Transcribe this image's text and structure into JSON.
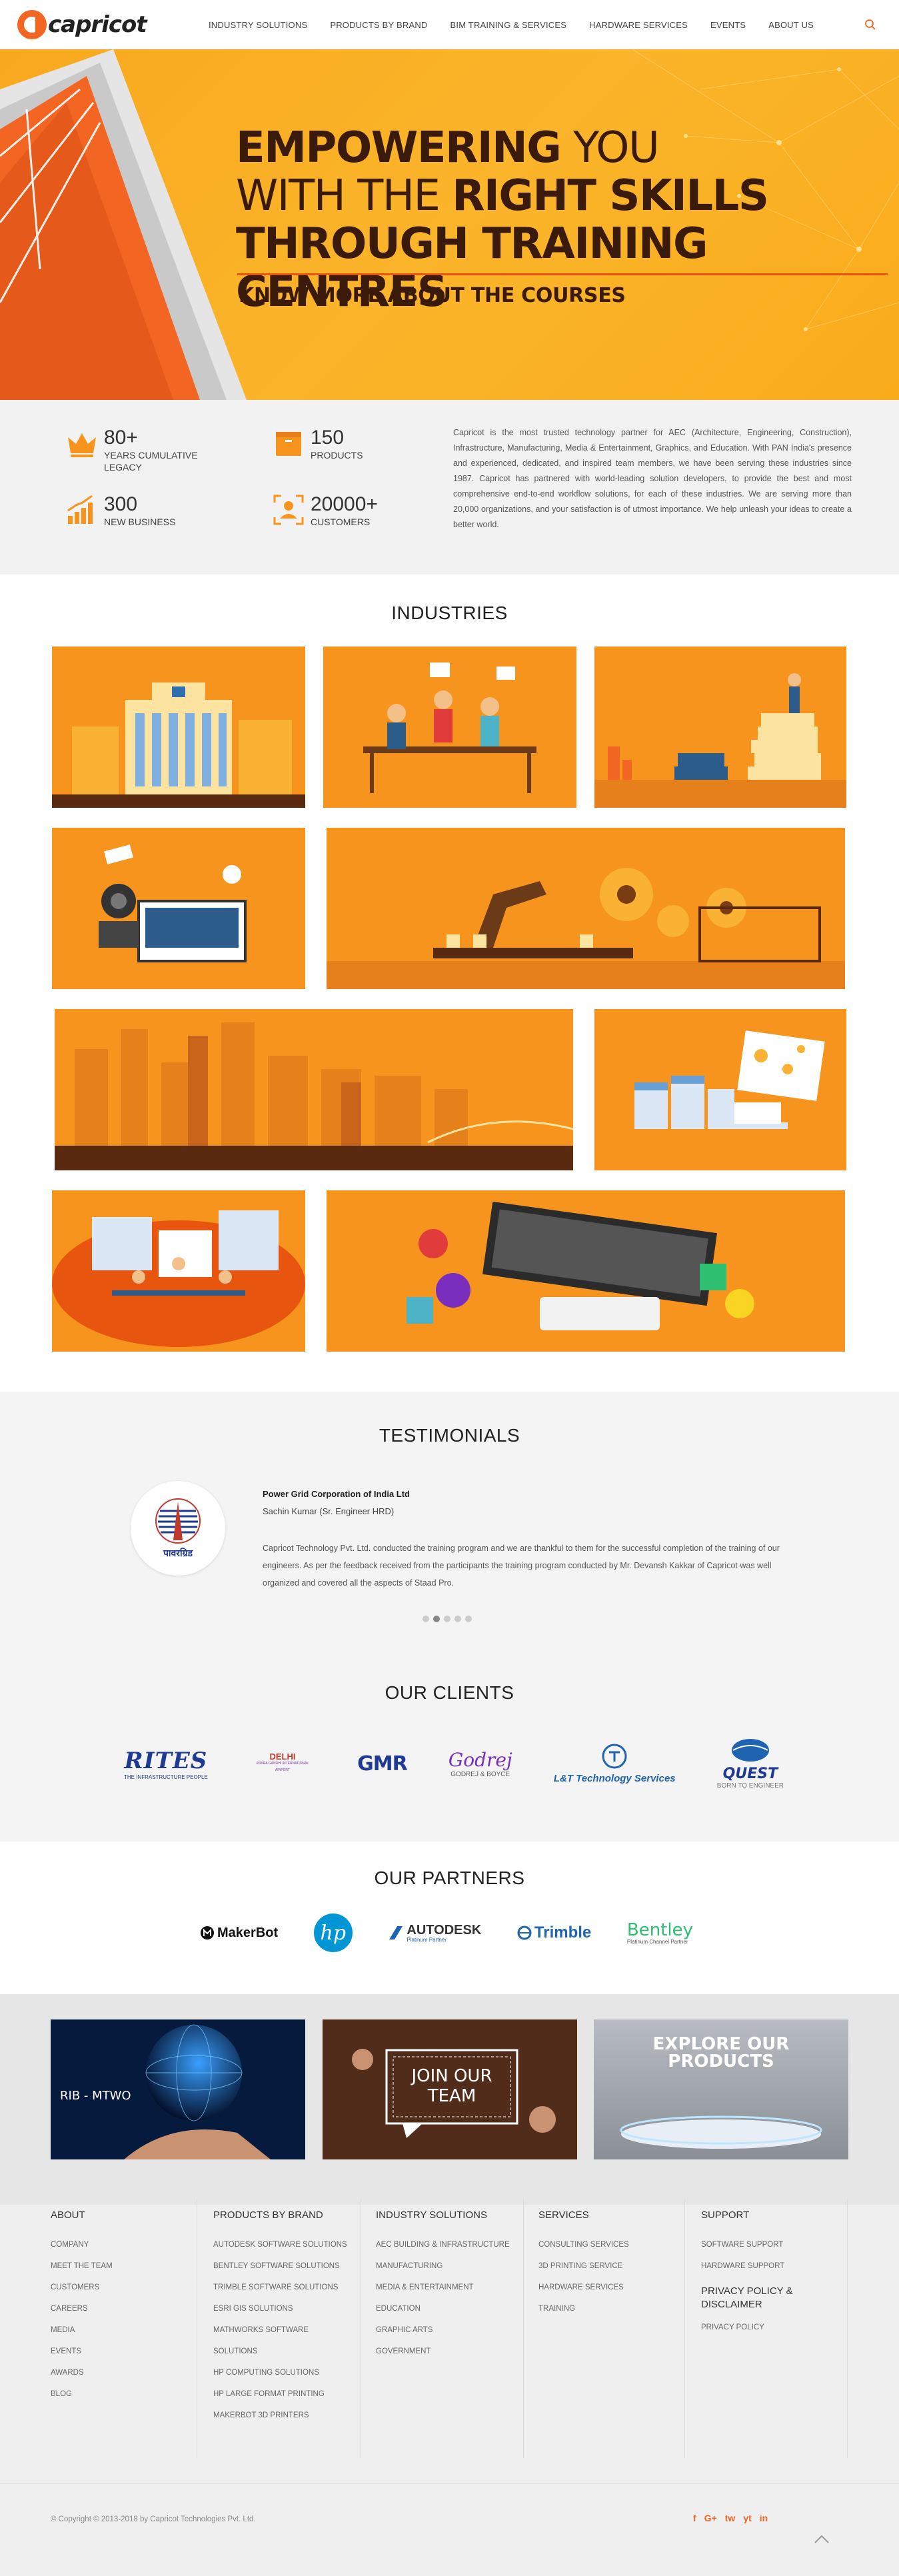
{
  "brand": {
    "name": "capricot",
    "accent": "#f26522",
    "hero_bg": "#fbb124"
  },
  "nav": {
    "items": [
      {
        "label": "INDUSTRY SOLUTIONS"
      },
      {
        "label": "PRODUCTS BY BRAND"
      },
      {
        "label": "BIM TRAINING & SERVICES"
      },
      {
        "label": "HARDWARE SERVICES"
      },
      {
        "label": "EVENTS"
      },
      {
        "label": "ABOUT US"
      }
    ],
    "search_icon": "search-icon"
  },
  "hero": {
    "line1_bold": "EMPOWERING",
    "line1_light": " YOU",
    "line2_light": "WITH THE ",
    "line2_bold": "RIGHT SKILLS",
    "line3_bold": "THROUGH TRAINING CENTRES",
    "cta": "KNOW MORE ABOUT THE COURSES"
  },
  "stats": [
    {
      "num": "80+",
      "label": "YEARS CUMULATIVE LEGACY",
      "icon": "crown-icon"
    },
    {
      "num": "150",
      "label": "PRODUCTS",
      "icon": "box-icon"
    },
    {
      "num": "300",
      "label": "NEW BUSINESS",
      "icon": "growth-chart-icon"
    },
    {
      "num": "20000+",
      "label": "CUSTOMERS",
      "icon": "customer-icon"
    }
  ],
  "about": "Capricot is the most trusted technology partner for AEC (Architecture, Engineering, Construction), Infrastructure, Manufacturing, Media & Entertainment, Graphics, and Education. With PAN India's presence and experienced, dedicated, and inspired team members, we have been serving these industries since 1987. Capricot has partnered with world-leading solution developers, to provide the best and most comprehensive end-to-end workflow solutions, for each of these industries. We are serving more than 20,000 organizations, and your satisfaction is of utmost importance. We help unleash your ideas to create a better world.",
  "industries": {
    "title": "INDUSTRIES"
  },
  "testimonials": {
    "title": "TESTIMONIALS",
    "org": "Power Grid Corporation of India Ltd",
    "person": "Sachin Kumar (Sr. Engineer HRD)",
    "text": "Capricot Technology Pvt. Ltd. conducted the training program and we are thankful to them for the successful completion of the training of our engineers. As per the feedback received from the participants the training program conducted by Mr. Devansh Kakkar of Capricot was well organized and covered all the aspects of Staad Pro.",
    "logo_text": "पावरग्रिड"
  },
  "clients": {
    "title": "OUR CLIENTS",
    "logos": [
      "RITES",
      "THE INFRASTRUCTURE PEOPLE",
      "DELHI",
      "INDIRA GANDHI INTERNATIONAL AIRPORT",
      "GMR",
      "Godrej",
      "GODREJ & BOYCE",
      "L&T Technology Services",
      "QUEST",
      "BORN TO ENGINEER"
    ]
  },
  "partners": {
    "title": "OUR PARTNERS",
    "logos": [
      "MakerBot",
      "hp",
      "AUTODESK",
      "Platinum Partner",
      "Trimble",
      "Bentley",
      "Platinum Channel Partner"
    ]
  },
  "promos": [
    {
      "label": "RIB - MTWO"
    },
    {
      "label": "JOIN OUR TEAM"
    },
    {
      "label": "EXPLORE OUR PRODUCTS"
    }
  ],
  "footer": {
    "columns": [
      {
        "title": "ABOUT",
        "links": [
          "COMPANY",
          "MEET THE TEAM",
          "CUSTOMERS",
          "CAREERS",
          "MEDIA",
          "EVENTS",
          "AWARDS",
          "BLOG"
        ]
      },
      {
        "title": "PRODUCTS BY BRAND",
        "links": [
          "AUTODESK SOFTWARE SOLUTIONS",
          "BENTLEY SOFTWARE SOLUTIONS",
          "TRIMBLE SOFTWARE SOLUTIONS",
          "ESRI GIS SOLUTIONS",
          "MATHWORKS SOFTWARE",
          "SOLUTIONS",
          "HP COMPUTING SOLUTIONS",
          "HP LARGE FORMAT PRINTING",
          "MAKERBOT 3D PRINTERS"
        ]
      },
      {
        "title": "INDUSTRY SOLUTIONS",
        "links": [
          "AEC BUILDING & INFRASTRUCTURE",
          "MANUFACTURING",
          "MEDIA & ENTERTAINMENT",
          "EDUCATION",
          "GRAPHIC ARTS",
          "GOVERNMENT"
        ]
      },
      {
        "title": "SERVICES",
        "links": [
          "CONSULTING SERVICES",
          "3D PRINTING SERVICE",
          "HARDWARE SERVICES",
          "TRAINING"
        ]
      },
      {
        "title": "SUPPORT",
        "links": [
          "SOFTWARE SUPPORT",
          "HARDWARE SUPPORT"
        ],
        "title2": "PRIVACY POLICY & DISCLAIMER",
        "links2": [
          "PRIVACY POLICY"
        ]
      }
    ],
    "copyright": "© Copyright © 2013-2018 by Capricot Technologies Pvt. Ltd.",
    "socials": [
      "f",
      "G+",
      "tw",
      "yt",
      "in"
    ]
  }
}
